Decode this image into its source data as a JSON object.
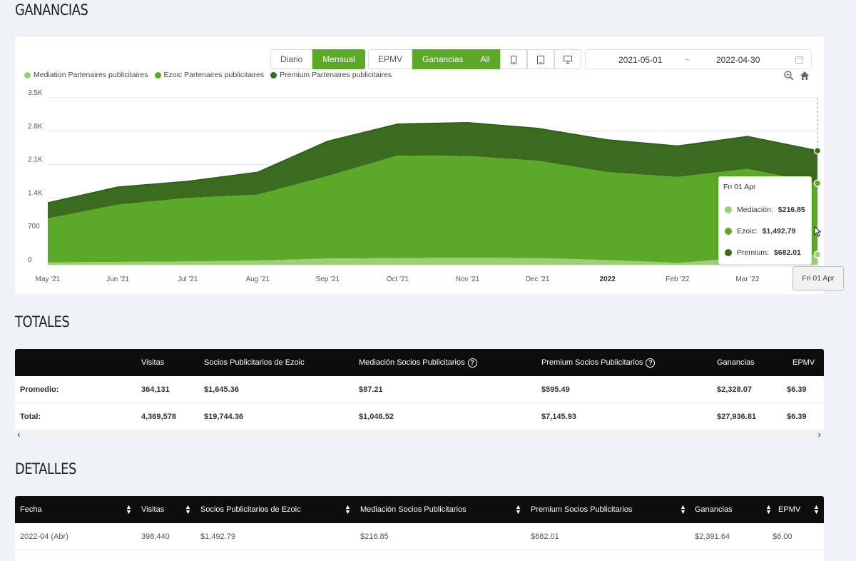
{
  "ganancias": {
    "title": "GANANCIAS",
    "period_buttons": [
      {
        "label": "Diario",
        "active": false
      },
      {
        "label": "Mensual",
        "active": true
      }
    ],
    "metric_buttons": [
      {
        "label": "EPMV",
        "active": false
      },
      {
        "label": "Ganancias",
        "active": true
      }
    ],
    "device_buttons": [
      {
        "label": "All",
        "active": true
      },
      {
        "icon": "mobile-icon"
      },
      {
        "icon": "tablet-icon"
      },
      {
        "icon": "desktop-icon"
      }
    ],
    "date_from": "2021-05-01",
    "date_sep": "~",
    "date_to": "2022-04-30",
    "legend": [
      {
        "label": "Mediation Partenaires publicitaires",
        "color": "#9dcf7a"
      },
      {
        "label": "Ezoic Partenaires publicitaires",
        "color": "#5ca829"
      },
      {
        "label": "Premium Partenaires publicitaires",
        "color": "#3a6b1f"
      }
    ],
    "tooltip": {
      "title": "Fri 01 Apr",
      "rows": [
        {
          "label": "Mediación:",
          "value": "$216.85",
          "color": "#9dcf7a"
        },
        {
          "label": "Ezoic:",
          "value": "$1,492.79",
          "color": "#5ca829"
        },
        {
          "label": "Premium:",
          "value": "$682.01",
          "color": "#3a6b1f"
        }
      ]
    },
    "x_tooltip": "Fri 01 Apr"
  },
  "chart_data": {
    "type": "area",
    "stacked": true,
    "categories": [
      "May '21",
      "Jun '21",
      "Jul '21",
      "Aug '21",
      "Sep '21",
      "Oct '21",
      "Nov '21",
      "Dec '21",
      "2022",
      "Feb '22",
      "Mar '22",
      "Apr"
    ],
    "x_tick_labels": [
      "May '21",
      "Jun '21",
      "Jul '21",
      "Aug '21",
      "Sep '21",
      "Oct '21",
      "Nov '21",
      "Dec '21",
      "2022",
      "Feb '22",
      "Mar '22"
    ],
    "y_tick_labels": [
      "0",
      "700",
      "1.4K",
      "2.1K",
      "2.8K",
      "3.5K"
    ],
    "ylim": [
      0,
      3500
    ],
    "grid": true,
    "series": [
      {
        "name": "Mediation Partenaires publicitaires",
        "color": "#9dcf7a",
        "values": [
          50,
          60,
          70,
          90,
          130,
          140,
          150,
          140,
          100,
          40,
          150,
          216.85
        ]
      },
      {
        "name": "Ezoic Partenaires publicitaires",
        "color": "#5ca829",
        "values": [
          920,
          1200,
          1330,
          1380,
          1730,
          2150,
          2130,
          2040,
          1840,
          1800,
          1860,
          1492.79
        ]
      },
      {
        "name": "Premium Partenaires publicitaires",
        "color": "#3a6b1f",
        "values": [
          330,
          370,
          350,
          470,
          730,
          660,
          700,
          680,
          680,
          650,
          680,
          682.01
        ]
      }
    ]
  },
  "totales": {
    "title": "TOTALES",
    "headers": [
      "",
      "Visitas",
      "Socios Publicitarios de Ezoic",
      "Mediación Socios Publicitarios",
      "Premium Socios Publicitarios",
      "Ganancias",
      "EPMV"
    ],
    "rows": [
      [
        "Promedio:",
        "364,131",
        "$1,645.36",
        "$87.21",
        "$595.49",
        "$2,328.07",
        "$6.39"
      ],
      [
        "Total:",
        "4,369,578",
        "$19,744.36",
        "$1,046.52",
        "$7,145.93",
        "$27,936.81",
        "$6.39"
      ]
    ],
    "scroll_left": "‹",
    "scroll_right": "›"
  },
  "detalles": {
    "title": "DETALLES",
    "headers": [
      "Fecha",
      "Visitas",
      "Socios Publicitarios de Ezoic",
      "Mediación Socios Publicitarios",
      "Premium Socios Publicitarios",
      "Ganancias",
      "EPMV"
    ],
    "rows": [
      [
        "2022-04 (Abr)",
        "398,440",
        "$1,492.79",
        "$216.85",
        "$682.01",
        "$2,391.64",
        "$6.00"
      ]
    ]
  }
}
